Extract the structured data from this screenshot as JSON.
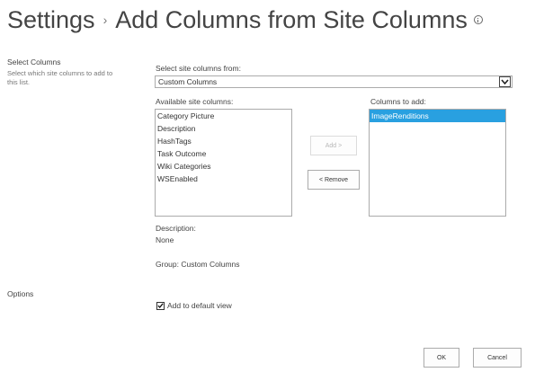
{
  "header": {
    "breadcrumb_root": "Settings",
    "separator": "›",
    "title": "Add Columns from Site Columns"
  },
  "select_section": {
    "heading": "Select Columns",
    "description": "Select which site columns to add to this list."
  },
  "source": {
    "label": "Select site columns from:",
    "selected": "Custom Columns"
  },
  "available": {
    "label": "Available site columns:",
    "items": [
      "Category Picture",
      "Description",
      "HashTags",
      "Task Outcome",
      "Wiki Categories",
      "WSEnabled"
    ]
  },
  "to_add": {
    "label": "Columns to add:",
    "items": [
      "ImageRenditions"
    ]
  },
  "buttons": {
    "add": "Add >",
    "remove": "< Remove",
    "ok": "OK",
    "cancel": "Cancel"
  },
  "details": {
    "description_label": "Description:",
    "description_value": "None",
    "group": "Group: Custom Columns"
  },
  "options": {
    "heading": "Options",
    "add_to_default_view": "Add to default view",
    "add_to_default_view_checked": true
  },
  "colors": {
    "selection": "#29a0e0",
    "text": "#333333"
  }
}
